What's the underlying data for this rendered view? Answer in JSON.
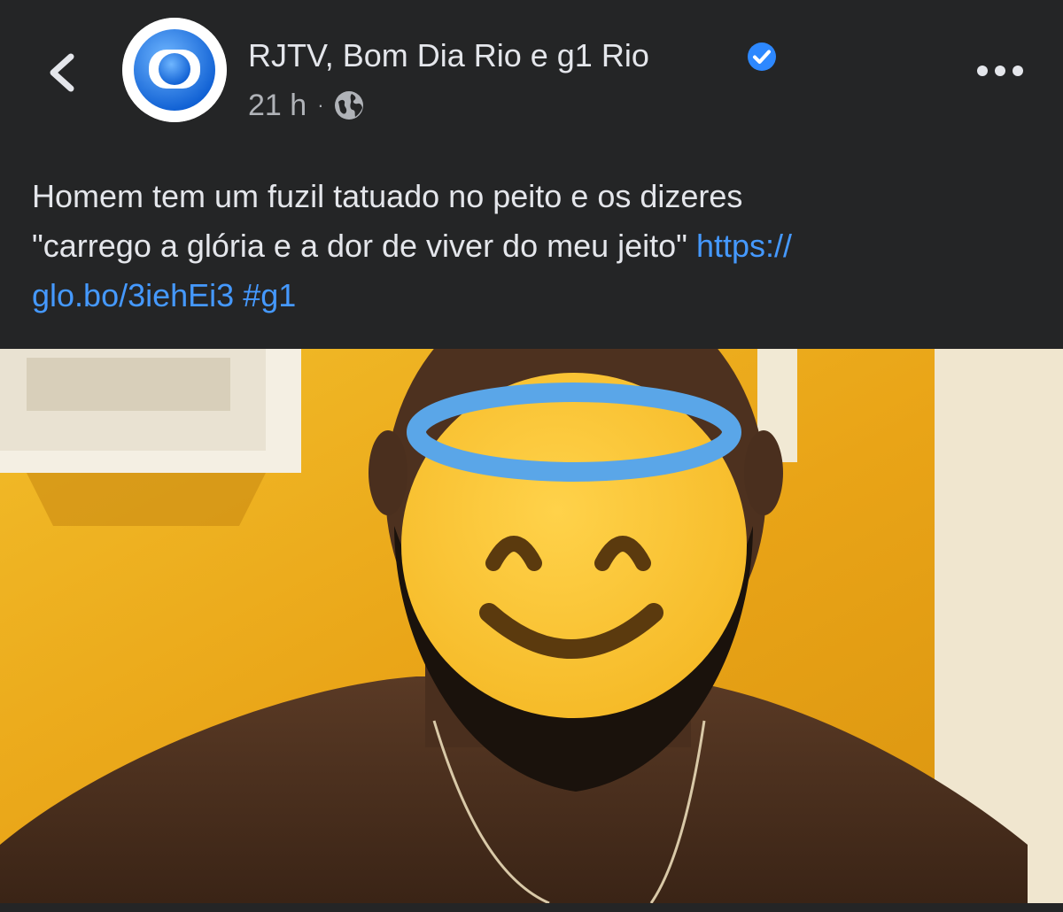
{
  "header": {
    "page_name": "RJTV, Bom Dia Rio e g1 Rio",
    "time": "21 h",
    "separator": "·",
    "icons": {
      "back": "chevron-left-icon",
      "verified": "verified-badge-icon",
      "audience": "globe-icon",
      "more": "more-horizontal-icon"
    }
  },
  "post": {
    "line1": "Homem tem um fuzil tatuado no peito e os dizeres",
    "line2": "\"carrego a glória e a dor de viver do meu jeito\"",
    "link_part1": "https://",
    "link_part2": "glo.bo/3iehEi3",
    "hashtag": "#g1"
  },
  "photo": {
    "overlay_emoji": "smiling-face-with-halo"
  },
  "colors": {
    "background": "#242526",
    "text": "#e4e6eb",
    "meta": "#b0b3b8",
    "link": "#4599ff",
    "verified": "#2d88ff"
  }
}
